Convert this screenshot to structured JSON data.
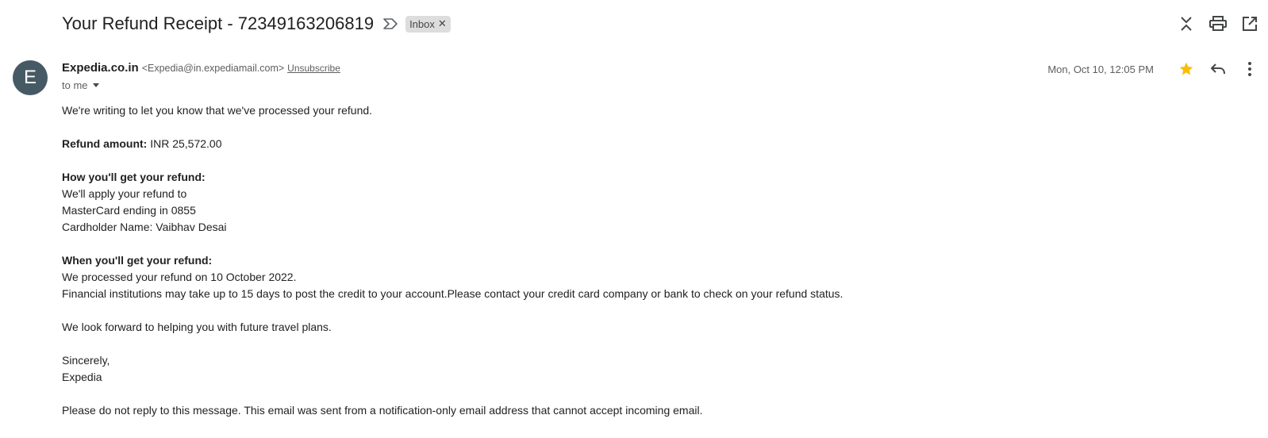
{
  "email": {
    "subject": "Your Refund Receipt - 72349163206819",
    "label": "Inbox",
    "sender": {
      "initial": "E",
      "name": "Expedia.co.in",
      "address": "<Expedia@in.expediamail.com>",
      "unsubscribe": "Unsubscribe"
    },
    "recipient": "to me",
    "date": "Mon, Oct 10, 12:05 PM",
    "starred": true,
    "colors": {
      "star": "#fbbc04",
      "avatar": "#455a64"
    },
    "body": {
      "intro": "We're writing to let you know that we've processed your refund.",
      "refund_amount_label": "Refund amount:",
      "refund_amount_value": "INR 25,572.00",
      "how_heading": "How you'll get your refund:",
      "how_line1": "We'll apply your refund to",
      "how_line2": "MasterCard ending in 0855",
      "how_line3": "Cardholder Name: Vaibhav Desai",
      "when_heading": "When you'll get your refund:",
      "when_line1": "We processed your refund on 10 October 2022.",
      "when_line2": "Financial institutions may take up to 15 days to post the credit to your account.Please contact your credit card company or bank to check on your refund status.",
      "future": "We look forward to helping you with future travel plans.",
      "signoff": "Sincerely,",
      "signature": "Expedia",
      "footer": "Please do not reply to this message. This email was sent from a notification-only email address that cannot accept incoming email."
    }
  },
  "icons": {
    "important": "important-marker-icon",
    "chip_close": "close-icon",
    "collapse": "collapse-all-icon",
    "print": "print-icon",
    "new_window": "open-in-new-window-icon",
    "star": "star-icon",
    "reply": "reply-icon",
    "more": "more-vertical-icon"
  }
}
